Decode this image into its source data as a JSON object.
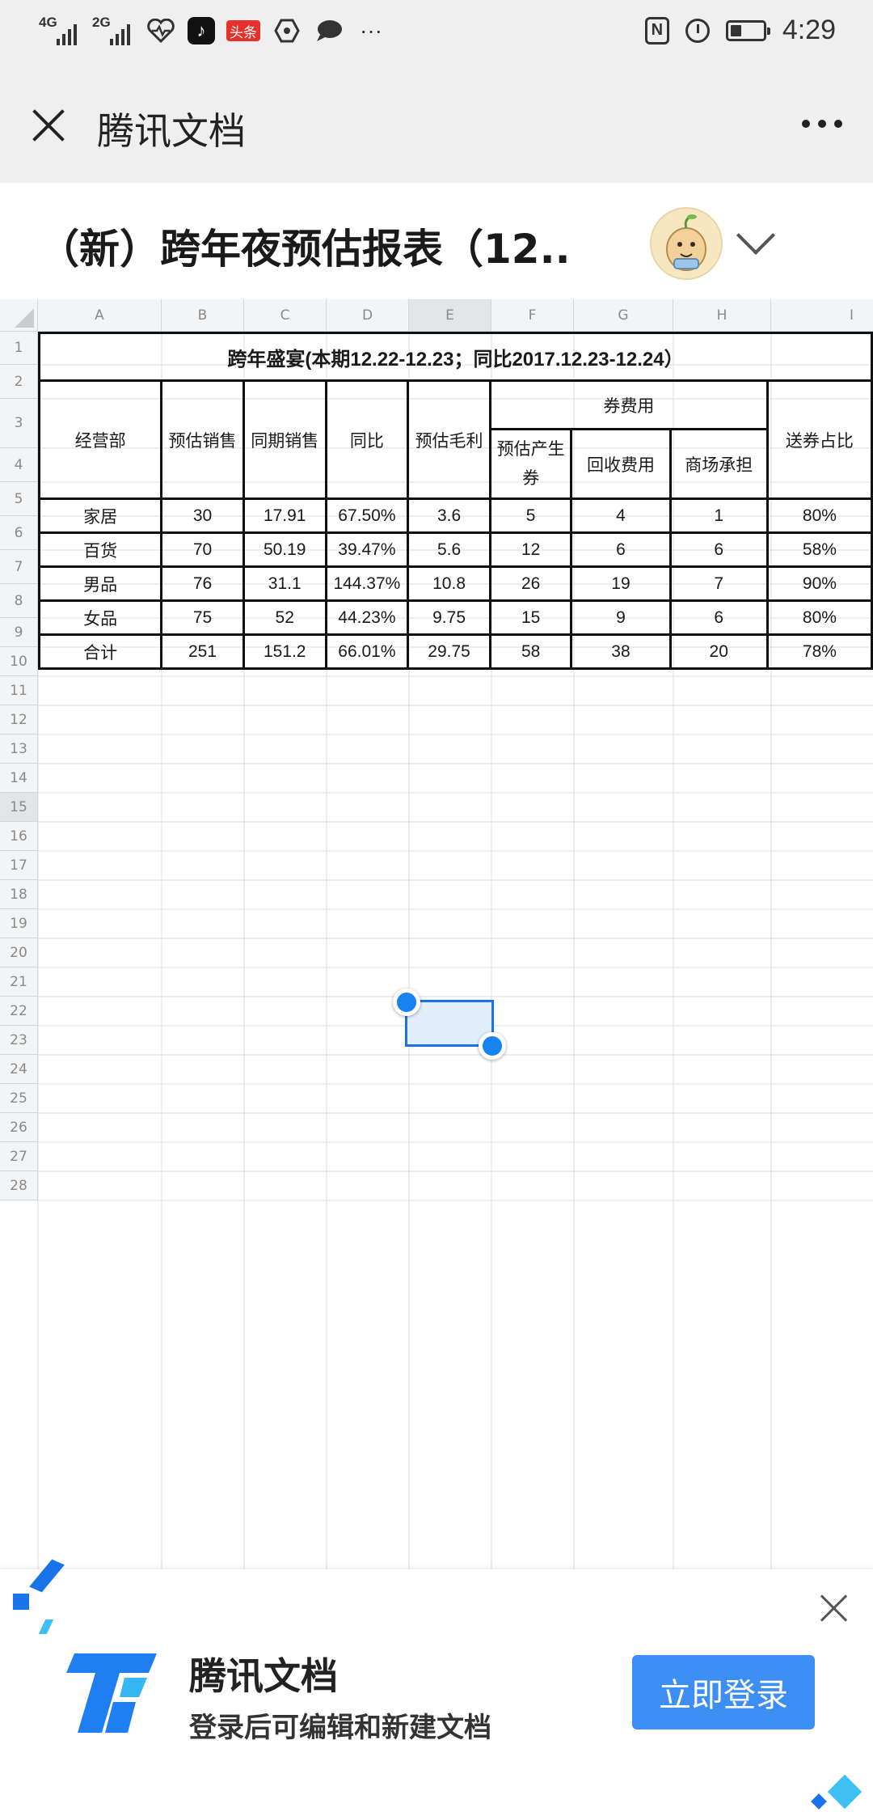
{
  "status_bar": {
    "left_icons": [
      {
        "network": "4G",
        "sub": "1",
        "name": "signal-1-icon"
      },
      {
        "network": "2G",
        "name": "signal-2-icon"
      },
      {
        "name": "heartbeat-icon"
      },
      {
        "name": "tiktok-icon"
      },
      {
        "name": "toutiao-icon",
        "label": "头条"
      },
      {
        "name": "hexagon-icon"
      },
      {
        "name": "chat-bubble-icon"
      },
      {
        "name": "more-dots-icon",
        "label": "···"
      }
    ],
    "right_icons": [
      "nfc-icon",
      "alarm-icon",
      "battery-icon"
    ],
    "nfc_label": "N",
    "battery_level": 0.35,
    "time": "4:29"
  },
  "app_bar": {
    "title": "腾讯文档",
    "close_icon": "close-icon",
    "more_icon": "more-icon"
  },
  "document": {
    "title": "（新）跨年夜预估报表（12..",
    "avatar": "user-avatar",
    "expand_icon": "chevron-down-icon"
  },
  "sheet": {
    "columns": [
      "A",
      "B",
      "C",
      "D",
      "E",
      "F",
      "G",
      "H",
      "I"
    ],
    "selected_column": "E",
    "rows": [
      "1",
      "2",
      "3",
      "4",
      "5",
      "6",
      "7",
      "8",
      "9",
      "10",
      "11",
      "12",
      "13",
      "14",
      "15",
      "16",
      "17",
      "18",
      "19",
      "20",
      "21",
      "22",
      "23",
      "24",
      "25",
      "26",
      "27",
      "28"
    ],
    "selected_row": "15",
    "table_title": "跨年盛宴(本期12.22-12.23；同比2017.12.23-12.24）",
    "header_row1": {
      "dept": "经营部",
      "est_sales": "预估销售",
      "prev_sales": "同期销售",
      "yoy": "同比",
      "est_margin": "预估毛利",
      "coupon_cost_group": "券费用",
      "coupon_share": "送券占比"
    },
    "header_row2": {
      "est_coupon": "预估产生券",
      "recovery_cost": "回收费用",
      "mall_borne": "商场承担"
    },
    "body_rows": [
      [
        "家居",
        "30",
        "17.91",
        "67.50%",
        "3.6",
        "5",
        "4",
        "1",
        "80%"
      ],
      [
        "百货",
        "70",
        "50.19",
        "39.47%",
        "5.6",
        "12",
        "6",
        "6",
        "58%"
      ],
      [
        "男品",
        "76",
        "31.1",
        "144.37%",
        "10.8",
        "26",
        "19",
        "7",
        "90%"
      ],
      [
        "女品",
        "75",
        "52",
        "44.23%",
        "9.75",
        "15",
        "9",
        "6",
        "80%"
      ],
      [
        "合计",
        "251",
        "151.2",
        "66.01%",
        "29.75",
        "58",
        "38",
        "20",
        "78%"
      ]
    ]
  },
  "login_banner": {
    "brand_name": "腾讯文档",
    "subtitle": "登录后可编辑和新建文档",
    "login_button": "立即登录",
    "close_icon": "close-icon",
    "logo": "tencent-docs-logo"
  },
  "colors": {
    "accent": "#1a73e8",
    "login_button": "#3d8ef2",
    "header_bg": "#efefef",
    "selection_fill": "#e3eefb"
  }
}
